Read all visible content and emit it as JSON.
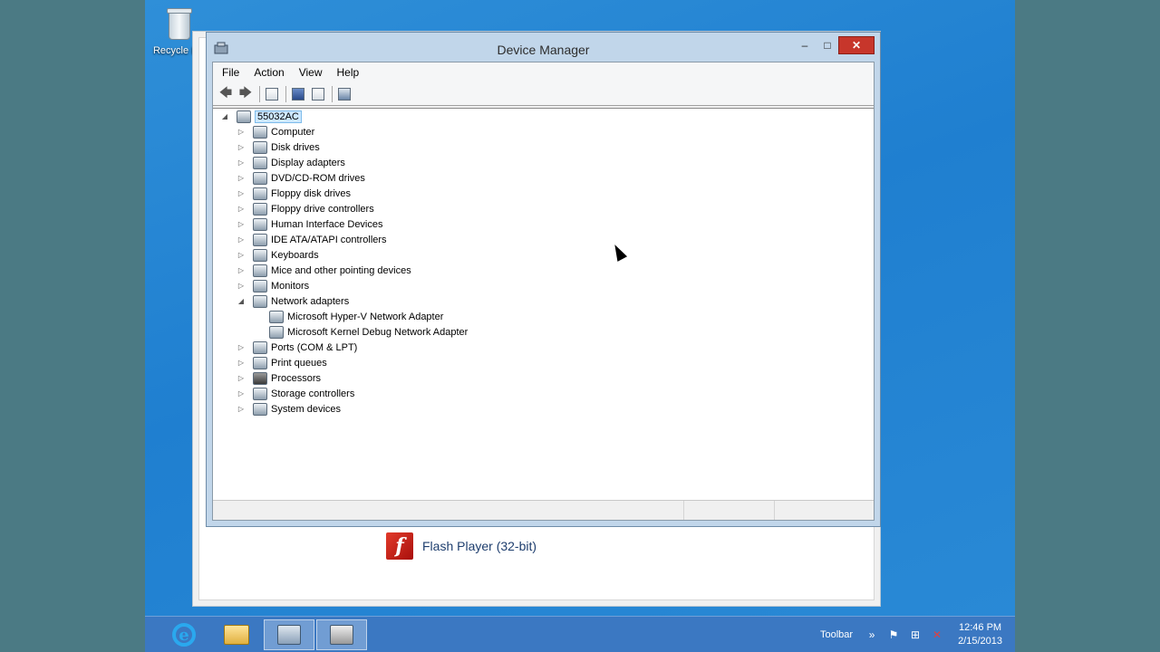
{
  "desktop": {
    "recycle_bin_label": "Recycle Bin"
  },
  "window": {
    "title": "Device Manager",
    "controls": {
      "minimize": "–",
      "maximize": "□",
      "close": "✕"
    }
  },
  "menu": [
    "File",
    "Action",
    "View",
    "Help"
  ],
  "toolbar": {
    "back": "🡄",
    "forward": "🡆"
  },
  "tree": {
    "root": "55032AC",
    "categories": [
      "Computer",
      "Disk drives",
      "Display adapters",
      "DVD/CD-ROM drives",
      "Floppy disk drives",
      "Floppy drive controllers",
      "Human Interface Devices",
      "IDE ATA/ATAPI controllers",
      "Keyboards",
      "Mice and other pointing devices",
      "Monitors",
      "Network adapters",
      "Microsoft Hyper-V Network Adapter",
      "Microsoft Kernel Debug Network Adapter",
      "Ports (COM & LPT)",
      "Print queues",
      "Processors",
      "Storage controllers",
      "System devices"
    ],
    "expanded_glyph": "◢",
    "collapsed_glyph": "▷"
  },
  "background_app": {
    "flash_icon_letter": "f",
    "flash_label": "Flash Player (32-bit)"
  },
  "taskbar": {
    "ie_letter": "e",
    "tray_label": "Toolbar",
    "tray_chevron": "»",
    "flag_glyph": "⚑",
    "net_glyph": "⊞",
    "sound_glyph": "✕",
    "time": "12:46 PM",
    "date": "2/15/2013"
  },
  "colors": {
    "desktop": "#1f7fd0",
    "taskbar": "#3b78c2",
    "close_button": "#c7362b",
    "selection": "#cde8ff"
  }
}
